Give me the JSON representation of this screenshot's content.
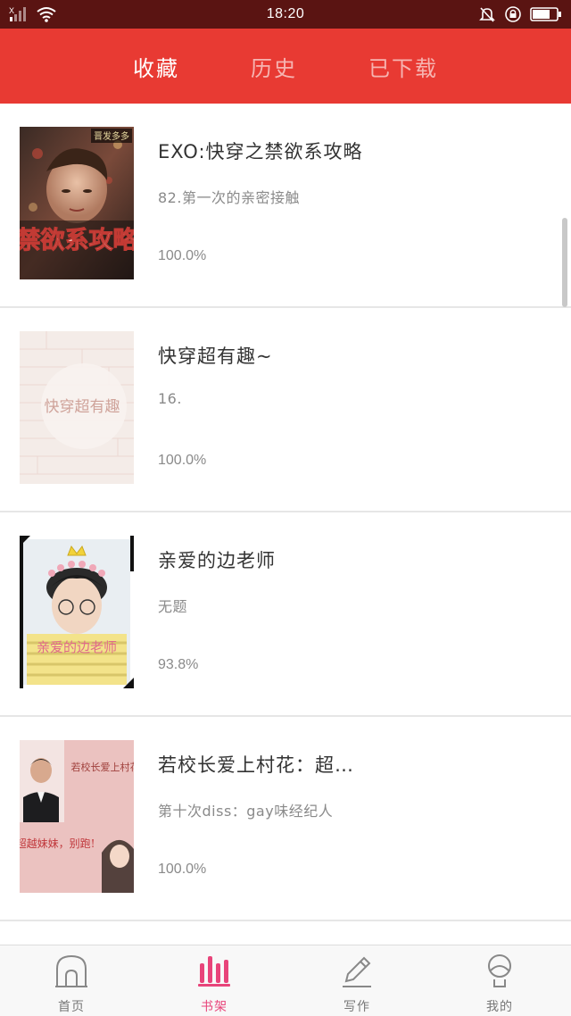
{
  "status_bar": {
    "time": "18:20",
    "signal_label": "X"
  },
  "header": {
    "tabs": [
      {
        "label": "收藏",
        "active": true
      },
      {
        "label": "历史",
        "active": false
      },
      {
        "label": "已下载",
        "active": false
      }
    ],
    "background": "#e83a33"
  },
  "books": [
    {
      "title": "EXO:快穿之禁欲系攻略",
      "chapter": "82.第一次的亲密接触",
      "progress": "100.0%",
      "cover_text": "禁欲系攻略",
      "cover_tag": "晋发多多"
    },
    {
      "title": "快穿超有趣~",
      "chapter": "16.",
      "progress": "100.0%",
      "cover_text": "快穿超有趣"
    },
    {
      "title": "亲爱的边老师",
      "chapter": "无题",
      "progress": "93.8%",
      "cover_text": "亲爱的边老师"
    },
    {
      "title": "若校长爱上村花：超…",
      "chapter": "第十次diss：gay味经纪人",
      "progress": "100.0%",
      "cover_text_top": "若校长爱上村花",
      "cover_text_bottom": "超越妹妹，别跑!"
    }
  ],
  "bottom_nav": [
    {
      "label": "首页",
      "icon": "home-icon",
      "active": false
    },
    {
      "label": "书架",
      "icon": "bookshelf-icon",
      "active": true
    },
    {
      "label": "写作",
      "icon": "pen-icon",
      "active": false
    },
    {
      "label": "我的",
      "icon": "profile-icon",
      "active": false
    }
  ],
  "colors": {
    "accent": "#e83a33",
    "nav_active": "#e8447a",
    "status_bar": "#5a1412"
  }
}
